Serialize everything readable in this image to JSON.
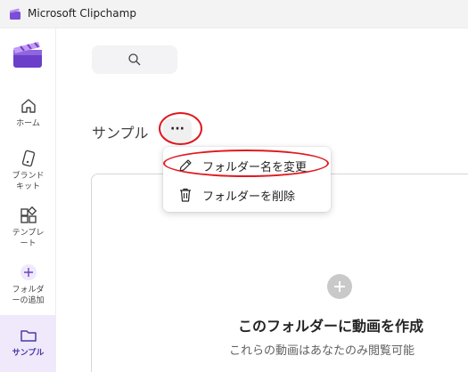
{
  "window": {
    "title": "Microsoft Clipchamp"
  },
  "sidebar": {
    "items": [
      {
        "label": "ホーム",
        "icon": "home-icon"
      },
      {
        "label": "ブランド\nキット",
        "icon": "brand-kit-icon"
      },
      {
        "label": "テンプレ\nート",
        "icon": "templates-icon"
      },
      {
        "label": "フォルダ\nーの追加",
        "icon": "add-icon"
      },
      {
        "label": "サンプル",
        "icon": "folder-icon"
      }
    ]
  },
  "search": {
    "icon": "search-icon"
  },
  "folder": {
    "title": "サンプル",
    "more_label": "···"
  },
  "context_menu": {
    "rename_label": "フォルダー名を変更",
    "delete_label": "フォルダーを削除"
  },
  "empty_state": {
    "title": "このフォルダーに動画を作成",
    "subtitle": "これらの動画はあなたのみ閲覧可能"
  },
  "colors": {
    "accent": "#4b3aa5",
    "highlight_ring": "#e0191f",
    "active_nav_bg": "#efe9fb"
  }
}
